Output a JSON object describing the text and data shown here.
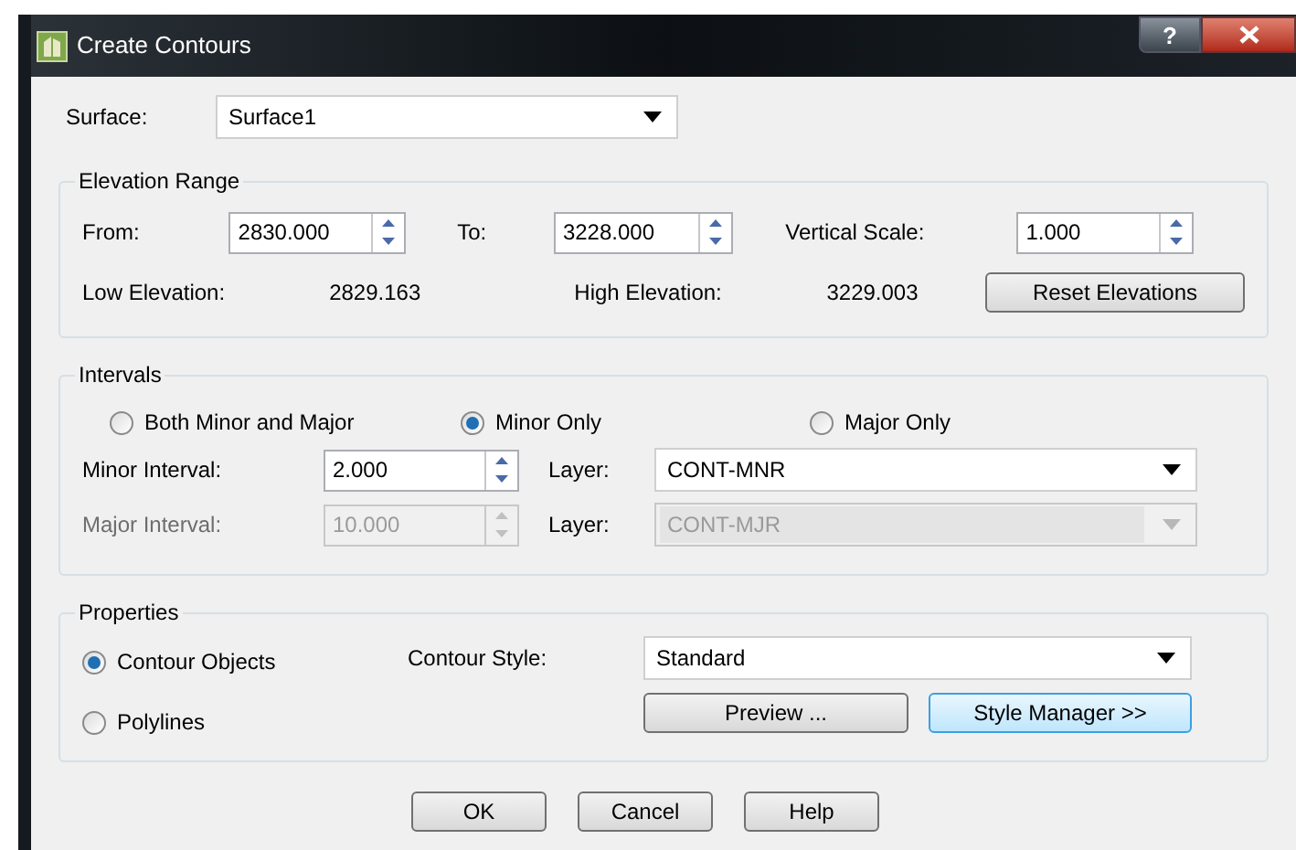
{
  "window": {
    "title": "Create Contours"
  },
  "title_buttons": [
    {
      "kind": "help",
      "label": "?"
    },
    {
      "kind": "close"
    }
  ],
  "surface": {
    "label": "Surface:",
    "value": "Surface1"
  },
  "elevation_range": {
    "title": "Elevation Range",
    "fields": [
      {
        "label": "From:",
        "value": "2830.000"
      },
      {
        "label": "To:",
        "value": "3228.000"
      },
      {
        "label": "Vertical Scale:",
        "value": "1.000"
      }
    ],
    "readings": [
      {
        "label": "Low Elevation:",
        "value": "2829.163"
      },
      {
        "label": "High Elevation:",
        "value": "3229.003"
      }
    ],
    "reset_button": "Reset Elevations"
  },
  "intervals": {
    "title": "Intervals",
    "modes": [
      {
        "label": "Both Minor and Major",
        "selected": false
      },
      {
        "label": "Minor Only",
        "selected": true
      },
      {
        "label": "Major Only",
        "selected": false
      }
    ],
    "rows": [
      {
        "label": "Minor Interval:",
        "value": "2.000",
        "layer_label": "Layer:",
        "layer": "CONT-MNR",
        "disabled": false
      },
      {
        "label": "Major Interval:",
        "value": "10.000",
        "layer_label": "Layer:",
        "layer": "CONT-MJR",
        "disabled": true
      }
    ]
  },
  "properties": {
    "title": "Properties",
    "outputs": [
      {
        "label": "Contour Objects",
        "selected": true
      },
      {
        "label": "Polylines",
        "selected": false
      }
    ],
    "contour_style": {
      "label": "Contour Style:",
      "value": "Standard"
    },
    "buttons": [
      {
        "label": "Preview ...",
        "focused": false
      },
      {
        "label": "Style Manager >>",
        "focused": true
      }
    ]
  },
  "buttons": [
    "OK",
    "Cancel",
    "Help"
  ]
}
